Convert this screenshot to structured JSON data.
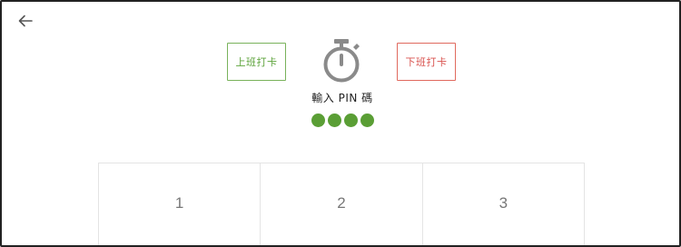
{
  "header": {
    "back_icon": "arrow-left-icon"
  },
  "actions": {
    "clock_in_label": "上班打卡",
    "clock_out_label": "下班打卡",
    "center_icon": "stopwatch-icon"
  },
  "pin": {
    "title": "輸入 PIN 碼",
    "entered_count": 4,
    "dot_color": "#5a9e35"
  },
  "keypad": {
    "keys": [
      "1",
      "2",
      "3"
    ]
  },
  "colors": {
    "clock_in": "#5da33b",
    "clock_out": "#d9534f",
    "icon_gray": "#8a8a8a"
  }
}
